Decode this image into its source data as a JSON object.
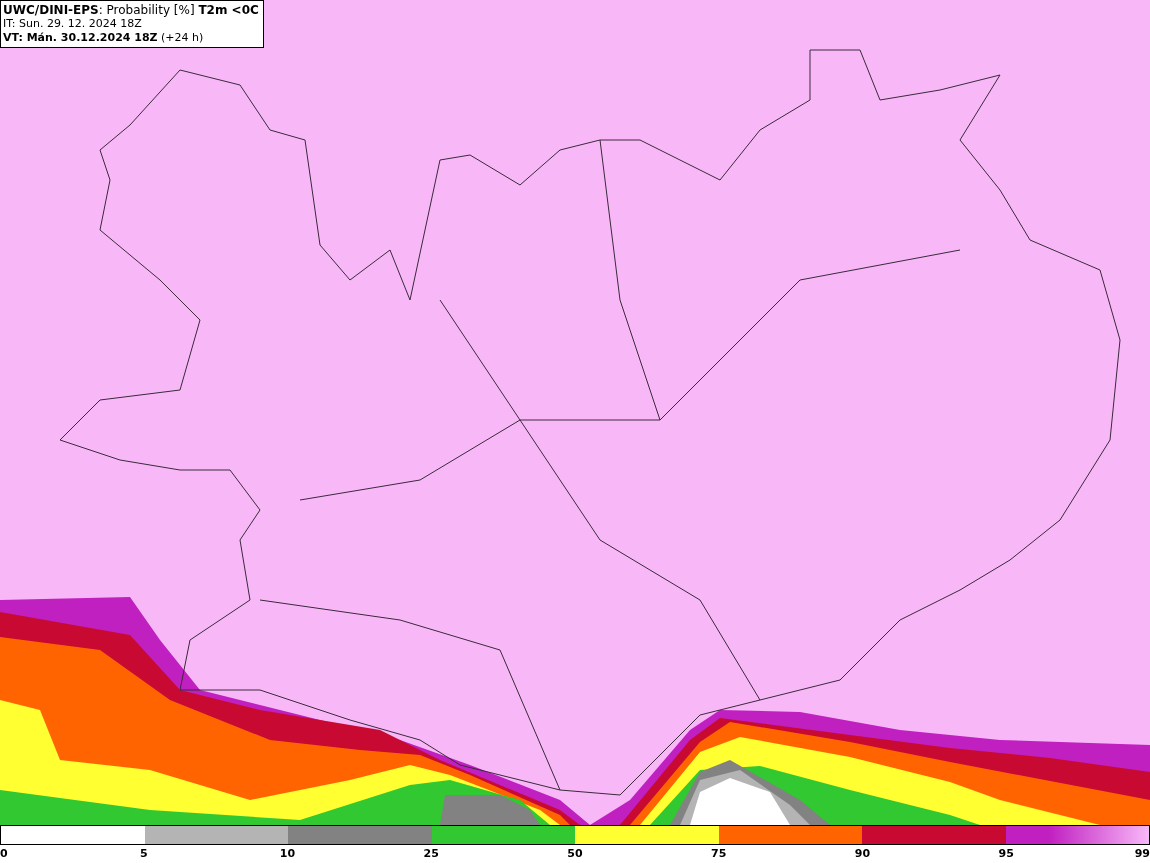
{
  "header": {
    "lines": [
      "**UWC/DINI-EPS**: Probability [%] **T2m <0C**",
      "IT: Sun. 29. 12. 2024 18Z",
      "**VT: Mán. 30.12.2024 18Z** (+24 h)"
    ]
  },
  "legend": {
    "segments": [
      {
        "color": "#ffffff"
      },
      {
        "color": "#b4b4b4"
      },
      {
        "color": "#828282"
      },
      {
        "color": "#32c832"
      },
      {
        "color": "#ffff32"
      },
      {
        "color": "#ff6400"
      },
      {
        "color": "#c80a32"
      },
      {
        "color": "#c020c0"
      }
    ],
    "ticks": [
      "0",
      "5",
      "10",
      "25",
      "50",
      "75",
      "90",
      "95",
      "99"
    ]
  }
}
